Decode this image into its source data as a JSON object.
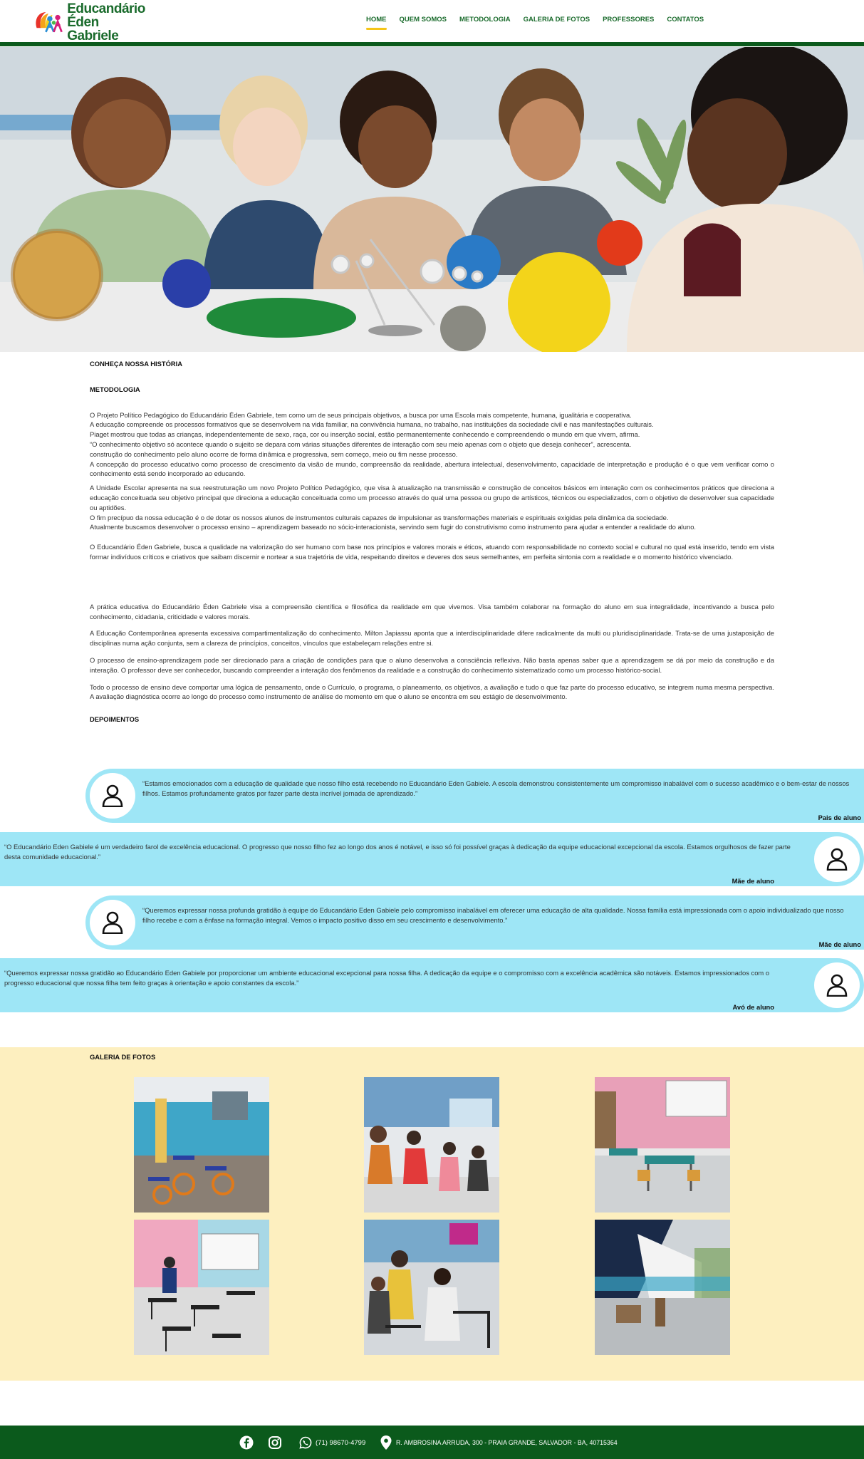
{
  "header": {
    "logo_line1": "Educandário",
    "logo_line2": "Éden Gabriele",
    "nav": [
      "HOME",
      "QUEM SOMOS",
      "METODOLOGIA",
      "GALERIA DE FOTOS",
      "PROFESSORES",
      "CONTATOS"
    ],
    "active_nav": "HOME"
  },
  "content": {
    "history_title": "CONHEÇA NOSSA HISTÓRIA",
    "methodology_title": "METODOLOGIA",
    "paragraphs": [
      "O Projeto Político Pedagógico do Educandário Éden Gabriele, tem como um de seus principais objetivos, a busca por uma Escola mais competente, humana, igualitária e cooperativa.\nA educação compreende os processos formativos que se desenvolvem na vida familiar, na convivência humana, no trabalho, nas instituições da sociedade civil e nas manifestações culturais.\nPiaget mostrou que todas as crianças, independentemente de sexo, raça, cor ou inserção social, estão permanentemente conhecendo e compreendendo o mundo em que vivem, afirma.\n“O conhecimento objetivo só acontece quando o sujeito se depara com várias situações diferentes de interação com seu meio apenas com o objeto que deseja conhecer”, acrescenta.\nconstrução do conhecimento pelo aluno ocorre de forma dinâmica e progressiva, sem começo, meio ou fim nesse processo.\nA concepção do processo educativo como processo de crescimento da visão de mundo, compreensão da realidade, abertura intelectual, desenvolvimento, capacidade de interpretação e produção é o que vem verificar como o conhecimento está sendo incorporado ao educando.",
      "A Unidade Escolar apresenta na sua reestruturação um novo Projeto Político Pedagógico, que visa à atualização na transmissão e construção de conceitos básicos em interação com os conhecimentos práticos que direciona a educação conceituada seu objetivo principal que direciona a educação conceituada como um processo através do qual uma pessoa ou grupo de artísticos, técnicos ou especializados, com o objetivo de desenvolver sua capacidade ou aptidões.\nO fim precípuo da nossa educação é o de dotar os nossos alunos de instrumentos culturais capazes de impulsionar as transformações materiais e espirituais exigidas pela dinâmica da sociedade.\nAtualmente buscamos desenvolver o processo ensino – aprendizagem baseado no sócio-interacionista, servindo sem fugir do construtivismo como instrumento para ajudar a entender a realidade do aluno.",
      "O Educandário Éden Gabriele, busca a qualidade na valorização do ser humano com base nos princípios e valores morais e éticos, atuando com responsabilidade no contexto social e cultural no qual está inserido, tendo em vista formar indivíduos críticos e criativos que saibam discernir e nortear a sua trajetória de vida, respeitando direitos e deveres dos seus semelhantes, em perfeita sintonia com a realidade e o momento histórico vivenciado.",
      "A prática educativa do Educandário Éden Gabriele visa a compreensão científica e filosófica da realidade em que vivemos. Visa também colaborar na formação do aluno em sua integralidade, incentivando a busca pelo conhecimento, cidadania, criticidade e valores morais.",
      "A Educação Contemporânea apresenta excessiva compartimentalização do conhecimento. Milton Japiassu aponta que a interdisciplinaridade difere radicalmente da multi ou pluridisciplinaridade. Trata-se de uma justaposição de disciplinas numa ação conjunta, sem a clareza de princípios, conceitos, vínculos que estabeleçam relações entre si.",
      "O processo de ensino-aprendizagem pode ser direcionado para a criação de condições para que o aluno desenvolva a consciência reflexiva. Não basta apenas saber que a aprendizagem se dá por meio da construção e da interação. O professor deve ser conhecedor, buscando compreender a interação dos fenômenos da realidade e a construção do conhecimento sistematizado como um processo histórico-social.",
      "Todo o processo de ensino deve comportar uma lógica de pensamento, onde o Currículo, o programa, o planeamento, os objetivos, a avaliação e tudo o que faz parte do processo educativo, se integrem numa mesma perspectiva. A avaliação diagnóstica ocorre ao longo do processo como instrumento de análise do momento em que o aluno se encontra em seu estágio de desenvolvimento."
    ],
    "testimonials_title": "DEPOIMENTOS"
  },
  "testimonials": [
    {
      "quote": "“Estamos emocionados com a educação de qualidade que nosso filho está recebendo no Educandário Eden Gabiele. A escola demonstrou consistentemente um compromisso inabalável com o sucesso acadêmico e o bem-estar de nossos filhos. Estamos profundamente gratos por fazer parte desta incrível jornada de aprendizado.”",
      "author": "Pais de aluno"
    },
    {
      "quote": "“O Educandário Eden Gabiele é um verdadeiro farol de excelência educacional. O progresso que nosso filho fez ao longo dos anos é notável, e isso só foi possível graças à dedicação da equipe educacional excepcional da escola. Estamos orgulhosos de fazer parte desta comunidade educacional.”",
      "author": "Mãe de aluno"
    },
    {
      "quote": "“Queremos expressar nossa profunda gratidão à equipe do Educandário Eden Gabiele pelo compromisso inabalável em oferecer uma educação de alta qualidade. Nossa família está impressionada com o apoio individualizado que nosso filho recebe e com a ênfase na formação integral. Vemos o impacto positivo disso em seu crescimento e desenvolvimento.”",
      "author": "Mãe de aluno"
    },
    {
      "quote": "“Queremos expressar nossa gratidão ao Educandário Eden Gabiele por proporcionar um ambiente educacional excepcional para nossa filha. A dedicação da equipe e o compromisso com a excelência acadêmica são notáveis. Estamos impressionados com o progresso educacional que nossa filha tem feito graças à orientação e apoio constantes da escola.”",
      "author": "Avó de aluno"
    }
  ],
  "gallery": {
    "title": "GALERIA DE FOTOS"
  },
  "footer": {
    "phone": "(71) 98670-4799",
    "address": "R. AMBROSINA ARRUDA, 300 - PRAIA GRANDE, SALVADOR - BA, 40715364"
  },
  "colors": {
    "brand_green": "#0b5a1c",
    "nav_green": "#1a6b2c",
    "accent_yellow": "#f5c518",
    "testimonial_bg": "#9ee6f6",
    "gallery_bg": "#fdefbf"
  }
}
